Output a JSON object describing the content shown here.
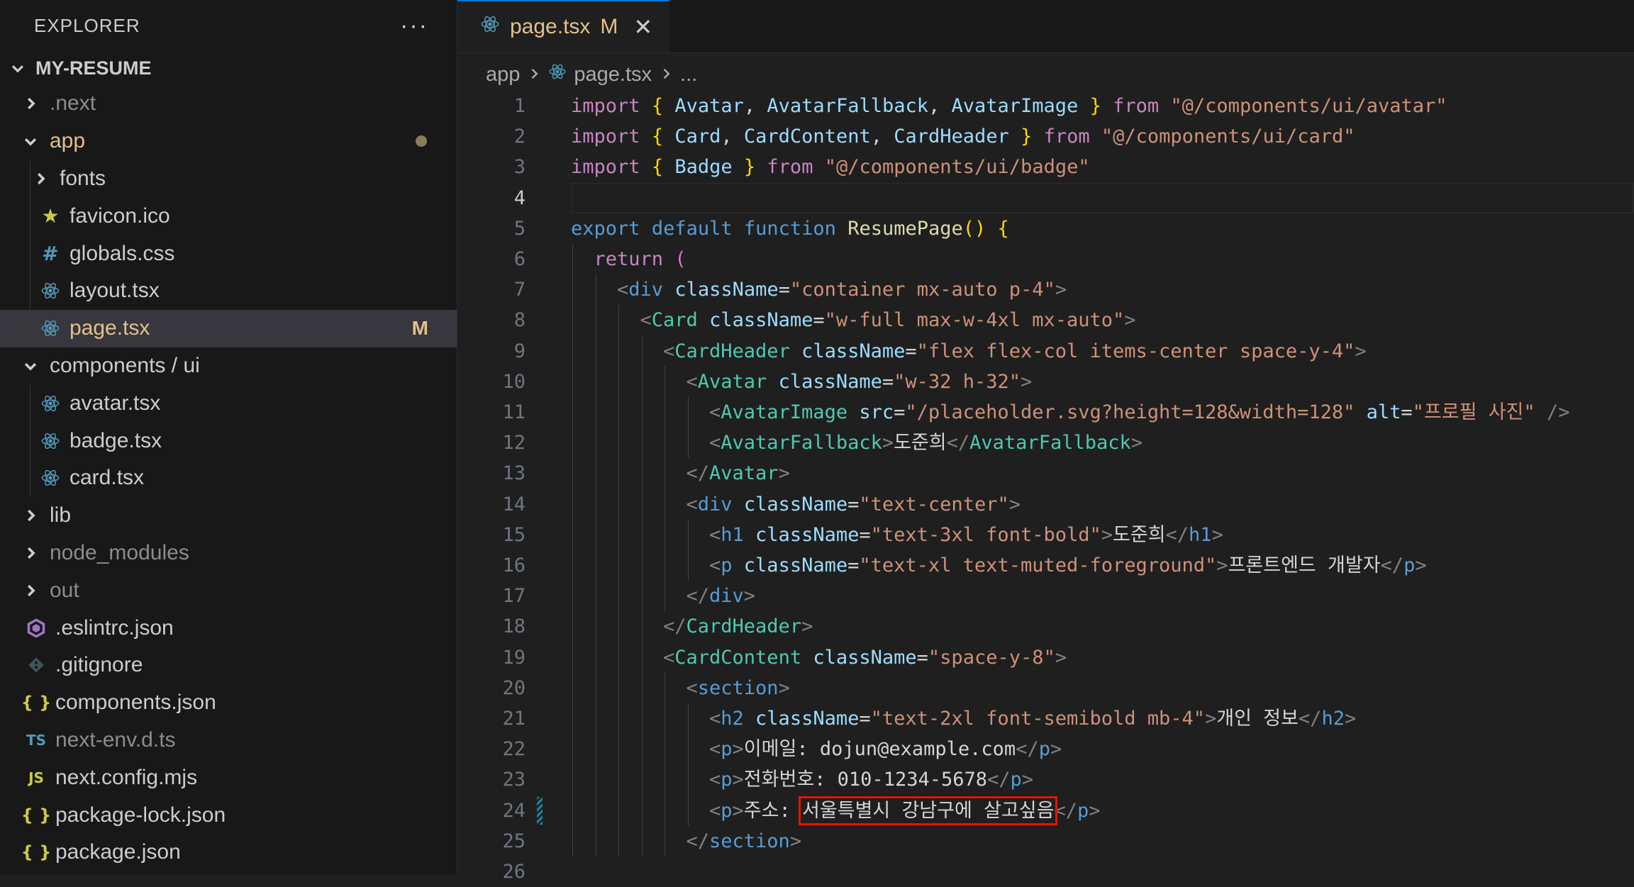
{
  "explorer": {
    "title": "EXPLORER",
    "more": "···",
    "project": "MY-RESUME",
    "items": [
      {
        "label": ".next",
        "depth": 1,
        "kind": "folder-closed",
        "dim": true
      },
      {
        "label": "app",
        "depth": 1,
        "kind": "folder-open",
        "modified": true,
        "dot": true
      },
      {
        "label": "fonts",
        "depth": 2,
        "kind": "folder-closed"
      },
      {
        "label": "favicon.ico",
        "depth": 2,
        "kind": "file",
        "icon": "star-icon"
      },
      {
        "label": "globals.css",
        "depth": 2,
        "kind": "file",
        "icon": "hash-icon"
      },
      {
        "label": "layout.tsx",
        "depth": 2,
        "kind": "file",
        "icon": "react-icon"
      },
      {
        "label": "page.tsx",
        "depth": 2,
        "kind": "file",
        "icon": "react-icon",
        "selected": true,
        "modified": true,
        "status": "M"
      },
      {
        "label": "components / ui",
        "depth": 1,
        "kind": "folder-open"
      },
      {
        "label": "avatar.tsx",
        "depth": 2,
        "kind": "file",
        "icon": "react-icon"
      },
      {
        "label": "badge.tsx",
        "depth": 2,
        "kind": "file",
        "icon": "react-icon"
      },
      {
        "label": "card.tsx",
        "depth": 2,
        "kind": "file",
        "icon": "react-icon"
      },
      {
        "label": "lib",
        "depth": 1,
        "kind": "folder-closed"
      },
      {
        "label": "node_modules",
        "depth": 1,
        "kind": "folder-closed",
        "dim": true
      },
      {
        "label": "out",
        "depth": 1,
        "kind": "folder-closed",
        "dim": true
      },
      {
        "label": ".eslintrc.json",
        "depth": 1,
        "kind": "file",
        "icon": "eslint-icon"
      },
      {
        "label": ".gitignore",
        "depth": 1,
        "kind": "file",
        "icon": "git-icon"
      },
      {
        "label": "components.json",
        "depth": 1,
        "kind": "file",
        "icon": "json-icon"
      },
      {
        "label": "next-env.d.ts",
        "depth": 1,
        "kind": "file",
        "icon": "ts-icon",
        "dim": true
      },
      {
        "label": "next.config.mjs",
        "depth": 1,
        "kind": "file",
        "icon": "js-icon"
      },
      {
        "label": "package-lock.json",
        "depth": 1,
        "kind": "file",
        "icon": "json-icon"
      },
      {
        "label": "package.json",
        "depth": 1,
        "kind": "file",
        "icon": "json-icon"
      }
    ]
  },
  "tab": {
    "name": "page.tsx",
    "status": "M",
    "close": "✕"
  },
  "breadcrumb": {
    "folder": "app",
    "file": "page.tsx",
    "more": "..."
  },
  "colors": {
    "accent": "#0078d4",
    "modified": "#e2c08d",
    "highlight_box": "#e51400"
  },
  "code": {
    "current_line": 4,
    "lines": [
      {
        "n": 1,
        "indent": 0,
        "tokens": [
          [
            "k",
            "import"
          ],
          [
            "tx",
            " "
          ],
          [
            "br",
            "{"
          ],
          [
            "tx",
            " "
          ],
          [
            "id",
            "Avatar"
          ],
          [
            "tx",
            ", "
          ],
          [
            "id",
            "AvatarFallback"
          ],
          [
            "tx",
            ", "
          ],
          [
            "id",
            "AvatarImage"
          ],
          [
            "tx",
            " "
          ],
          [
            "br",
            "}"
          ],
          [
            "tx",
            " "
          ],
          [
            "k",
            "from"
          ],
          [
            "tx",
            " "
          ],
          [
            "s",
            "\"@/components/ui/avatar\""
          ]
        ]
      },
      {
        "n": 2,
        "indent": 0,
        "tokens": [
          [
            "k",
            "import"
          ],
          [
            "tx",
            " "
          ],
          [
            "br",
            "{"
          ],
          [
            "tx",
            " "
          ],
          [
            "id",
            "Card"
          ],
          [
            "tx",
            ", "
          ],
          [
            "id",
            "CardContent"
          ],
          [
            "tx",
            ", "
          ],
          [
            "id",
            "CardHeader"
          ],
          [
            "tx",
            " "
          ],
          [
            "br",
            "}"
          ],
          [
            "tx",
            " "
          ],
          [
            "k",
            "from"
          ],
          [
            "tx",
            " "
          ],
          [
            "s",
            "\"@/components/ui/card\""
          ]
        ]
      },
      {
        "n": 3,
        "indent": 0,
        "tokens": [
          [
            "k",
            "import"
          ],
          [
            "tx",
            " "
          ],
          [
            "br",
            "{"
          ],
          [
            "tx",
            " "
          ],
          [
            "id",
            "Badge"
          ],
          [
            "tx",
            " "
          ],
          [
            "br",
            "}"
          ],
          [
            "tx",
            " "
          ],
          [
            "k",
            "from"
          ],
          [
            "tx",
            " "
          ],
          [
            "s",
            "\"@/components/ui/badge\""
          ]
        ]
      },
      {
        "n": 4,
        "indent": 0,
        "tokens": []
      },
      {
        "n": 5,
        "indent": 0,
        "tokens": [
          [
            "kb",
            "export"
          ],
          [
            "tx",
            " "
          ],
          [
            "kb",
            "default"
          ],
          [
            "tx",
            " "
          ],
          [
            "kb",
            "function"
          ],
          [
            "tx",
            " "
          ],
          [
            "fn",
            "ResumePage"
          ],
          [
            "br",
            "()"
          ],
          [
            "tx",
            " "
          ],
          [
            "br",
            "{"
          ]
        ]
      },
      {
        "n": 6,
        "indent": 1,
        "tokens": [
          [
            "k",
            "return"
          ],
          [
            "tx",
            " "
          ],
          [
            "pr",
            "("
          ]
        ]
      },
      {
        "n": 7,
        "indent": 2,
        "tokens": [
          [
            "p",
            "<"
          ],
          [
            "tg",
            "div"
          ],
          [
            "tx",
            " "
          ],
          [
            "at",
            "className"
          ],
          [
            "tx",
            "="
          ],
          [
            "s",
            "\"container mx-auto p-4\""
          ],
          [
            "p",
            ">"
          ]
        ]
      },
      {
        "n": 8,
        "indent": 3,
        "tokens": [
          [
            "p",
            "<"
          ],
          [
            "cp",
            "Card"
          ],
          [
            "tx",
            " "
          ],
          [
            "at",
            "className"
          ],
          [
            "tx",
            "="
          ],
          [
            "s",
            "\"w-full max-w-4xl mx-auto\""
          ],
          [
            "p",
            ">"
          ]
        ]
      },
      {
        "n": 9,
        "indent": 4,
        "tokens": [
          [
            "p",
            "<"
          ],
          [
            "cp",
            "CardHeader"
          ],
          [
            "tx",
            " "
          ],
          [
            "at",
            "className"
          ],
          [
            "tx",
            "="
          ],
          [
            "s",
            "\"flex flex-col items-center space-y-4\""
          ],
          [
            "p",
            ">"
          ]
        ]
      },
      {
        "n": 10,
        "indent": 5,
        "tokens": [
          [
            "p",
            "<"
          ],
          [
            "cp",
            "Avatar"
          ],
          [
            "tx",
            " "
          ],
          [
            "at",
            "className"
          ],
          [
            "tx",
            "="
          ],
          [
            "s",
            "\"w-32 h-32\""
          ],
          [
            "p",
            ">"
          ]
        ]
      },
      {
        "n": 11,
        "indent": 6,
        "tokens": [
          [
            "p",
            "<"
          ],
          [
            "cp",
            "AvatarImage"
          ],
          [
            "tx",
            " "
          ],
          [
            "at",
            "src"
          ],
          [
            "tx",
            "="
          ],
          [
            "s",
            "\"/placeholder.svg?height=128&width=128\""
          ],
          [
            "tx",
            " "
          ],
          [
            "at",
            "alt"
          ],
          [
            "tx",
            "="
          ],
          [
            "s",
            "\"프로필 사진\""
          ],
          [
            "tx",
            " "
          ],
          [
            "p",
            "/>"
          ]
        ]
      },
      {
        "n": 12,
        "indent": 6,
        "tokens": [
          [
            "p",
            "<"
          ],
          [
            "cp",
            "AvatarFallback"
          ],
          [
            "p",
            ">"
          ],
          [
            "tx",
            "도준희"
          ],
          [
            "p",
            "</"
          ],
          [
            "cp",
            "AvatarFallback"
          ],
          [
            "p",
            ">"
          ]
        ]
      },
      {
        "n": 13,
        "indent": 5,
        "tokens": [
          [
            "p",
            "</"
          ],
          [
            "cp",
            "Avatar"
          ],
          [
            "p",
            ">"
          ]
        ]
      },
      {
        "n": 14,
        "indent": 5,
        "tokens": [
          [
            "p",
            "<"
          ],
          [
            "tg",
            "div"
          ],
          [
            "tx",
            " "
          ],
          [
            "at",
            "className"
          ],
          [
            "tx",
            "="
          ],
          [
            "s",
            "\"text-center\""
          ],
          [
            "p",
            ">"
          ]
        ]
      },
      {
        "n": 15,
        "indent": 6,
        "tokens": [
          [
            "p",
            "<"
          ],
          [
            "tg",
            "h1"
          ],
          [
            "tx",
            " "
          ],
          [
            "at",
            "className"
          ],
          [
            "tx",
            "="
          ],
          [
            "s",
            "\"text-3xl font-bold\""
          ],
          [
            "p",
            ">"
          ],
          [
            "tx",
            "도준희"
          ],
          [
            "p",
            "</"
          ],
          [
            "tg",
            "h1"
          ],
          [
            "p",
            ">"
          ]
        ]
      },
      {
        "n": 16,
        "indent": 6,
        "tokens": [
          [
            "p",
            "<"
          ],
          [
            "tg",
            "p"
          ],
          [
            "tx",
            " "
          ],
          [
            "at",
            "className"
          ],
          [
            "tx",
            "="
          ],
          [
            "s",
            "\"text-xl text-muted-foreground\""
          ],
          [
            "p",
            ">"
          ],
          [
            "tx",
            "프론트엔드 개발자"
          ],
          [
            "p",
            "</"
          ],
          [
            "tg",
            "p"
          ],
          [
            "p",
            ">"
          ]
        ]
      },
      {
        "n": 17,
        "indent": 5,
        "tokens": [
          [
            "p",
            "</"
          ],
          [
            "tg",
            "div"
          ],
          [
            "p",
            ">"
          ]
        ]
      },
      {
        "n": 18,
        "indent": 4,
        "tokens": [
          [
            "p",
            "</"
          ],
          [
            "cp",
            "CardHeader"
          ],
          [
            "p",
            ">"
          ]
        ]
      },
      {
        "n": 19,
        "indent": 4,
        "tokens": [
          [
            "p",
            "<"
          ],
          [
            "cp",
            "CardContent"
          ],
          [
            "tx",
            " "
          ],
          [
            "at",
            "className"
          ],
          [
            "tx",
            "="
          ],
          [
            "s",
            "\"space-y-8\""
          ],
          [
            "p",
            ">"
          ]
        ]
      },
      {
        "n": 20,
        "indent": 5,
        "tokens": [
          [
            "p",
            "<"
          ],
          [
            "tg",
            "section"
          ],
          [
            "p",
            ">"
          ]
        ]
      },
      {
        "n": 21,
        "indent": 6,
        "tokens": [
          [
            "p",
            "<"
          ],
          [
            "tg",
            "h2"
          ],
          [
            "tx",
            " "
          ],
          [
            "at",
            "className"
          ],
          [
            "tx",
            "="
          ],
          [
            "s",
            "\"text-2xl font-semibold mb-4\""
          ],
          [
            "p",
            ">"
          ],
          [
            "tx",
            "개인 정보"
          ],
          [
            "p",
            "</"
          ],
          [
            "tg",
            "h2"
          ],
          [
            "p",
            ">"
          ]
        ]
      },
      {
        "n": 22,
        "indent": 6,
        "tokens": [
          [
            "p",
            "<"
          ],
          [
            "tg",
            "p"
          ],
          [
            "p",
            ">"
          ],
          [
            "tx",
            "이메일: dojun@example.com"
          ],
          [
            "p",
            "</"
          ],
          [
            "tg",
            "p"
          ],
          [
            "p",
            ">"
          ]
        ]
      },
      {
        "n": 23,
        "indent": 6,
        "tokens": [
          [
            "p",
            "<"
          ],
          [
            "tg",
            "p"
          ],
          [
            "p",
            ">"
          ],
          [
            "tx",
            "전화번호: 010-1234-5678"
          ],
          [
            "p",
            "</"
          ],
          [
            "tg",
            "p"
          ],
          [
            "p",
            ">"
          ]
        ]
      },
      {
        "n": 24,
        "indent": 6,
        "tokens": [
          [
            "p",
            "<"
          ],
          [
            "tg",
            "p"
          ],
          [
            "p",
            ">"
          ],
          [
            "tx",
            "주소: "
          ],
          [
            "tx",
            "서울특별시 강남구에 살고싶음"
          ],
          [
            "p",
            "</"
          ],
          [
            "tg",
            "p"
          ],
          [
            "p",
            ">"
          ]
        ],
        "modified": true
      },
      {
        "n": 25,
        "indent": 5,
        "tokens": [
          [
            "p",
            "</"
          ],
          [
            "tg",
            "section"
          ],
          [
            "p",
            ">"
          ]
        ]
      },
      {
        "n": 26,
        "indent": 0,
        "tokens": []
      }
    ]
  }
}
